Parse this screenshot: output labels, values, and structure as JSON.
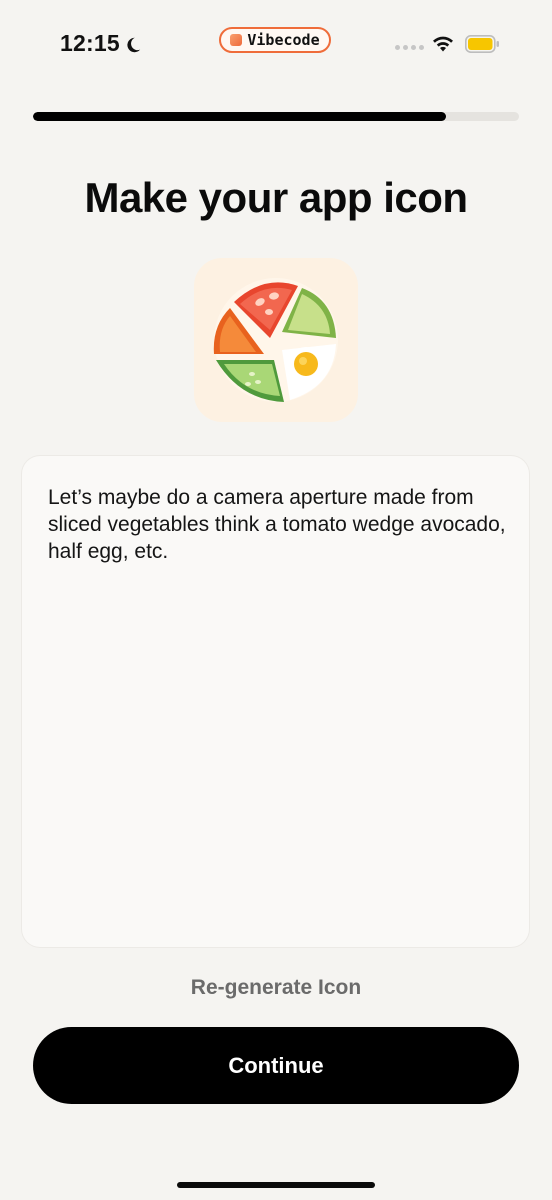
{
  "status_bar": {
    "time": "12:15",
    "app_pill_label": "Vibecode",
    "icons": [
      "moon-icon",
      "signal-icon",
      "wifi-icon",
      "battery-icon"
    ],
    "pill_border_color": "#ef6c3a",
    "battery_color": "#f7c600"
  },
  "onboarding": {
    "progress_percent": 85,
    "title": "Make your app icon",
    "app_icon_name": "vegetable-aperture-icon",
    "prompt_text": "Let’s maybe do a camera aperture made from sliced vegetables think a tomato wedge avocado, half egg, etc.",
    "regenerate_label": "Re-generate Icon",
    "continue_label": "Continue"
  }
}
